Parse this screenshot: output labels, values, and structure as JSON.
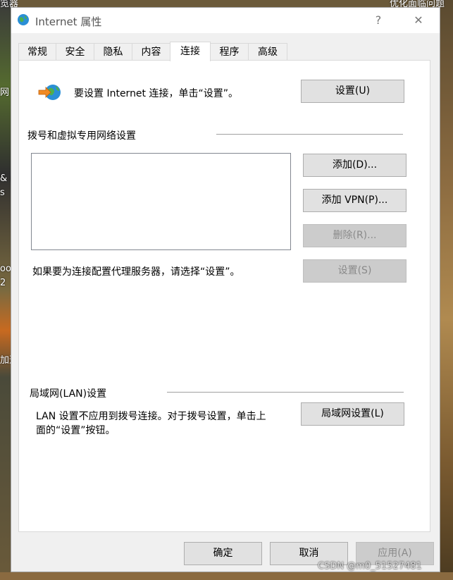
{
  "desktop": {
    "left_fragments": [
      "览器",
      "网",
      "& (",
      "s",
      "ool",
      "2",
      "加速"
    ],
    "right_fragment": "优化面临问题",
    "watermark": "CSDN @m0_51527481"
  },
  "window": {
    "title": "Internet 属性",
    "help_label": "?",
    "close_label": "✕"
  },
  "tabs": [
    "常规",
    "安全",
    "隐私",
    "内容",
    "连接",
    "程序",
    "高级"
  ],
  "active_tab": "连接",
  "connection": {
    "setup_text": "要设置 Internet 连接，单击“设置”。",
    "setup_button": "设置(U)",
    "dialup_heading": "拨号和虚拟专用网络设置",
    "add_button": "添加(D)...",
    "add_vpn_button": "添加 VPN(P)...",
    "remove_button": "删除(R)...",
    "proxy_text": "如果要为连接配置代理服务器，请选择“设置”。",
    "settings_button": "设置(S)",
    "lan_heading": "局域网(LAN)设置",
    "lan_text_line1": "LAN 设置不应用到拨号连接。对于拨号设置，单击上",
    "lan_text_line2": "面的“设置”按钮。",
    "lan_button": "局域网设置(L)"
  },
  "footer": {
    "ok": "确定",
    "cancel": "取消",
    "apply": "应用(A)"
  }
}
